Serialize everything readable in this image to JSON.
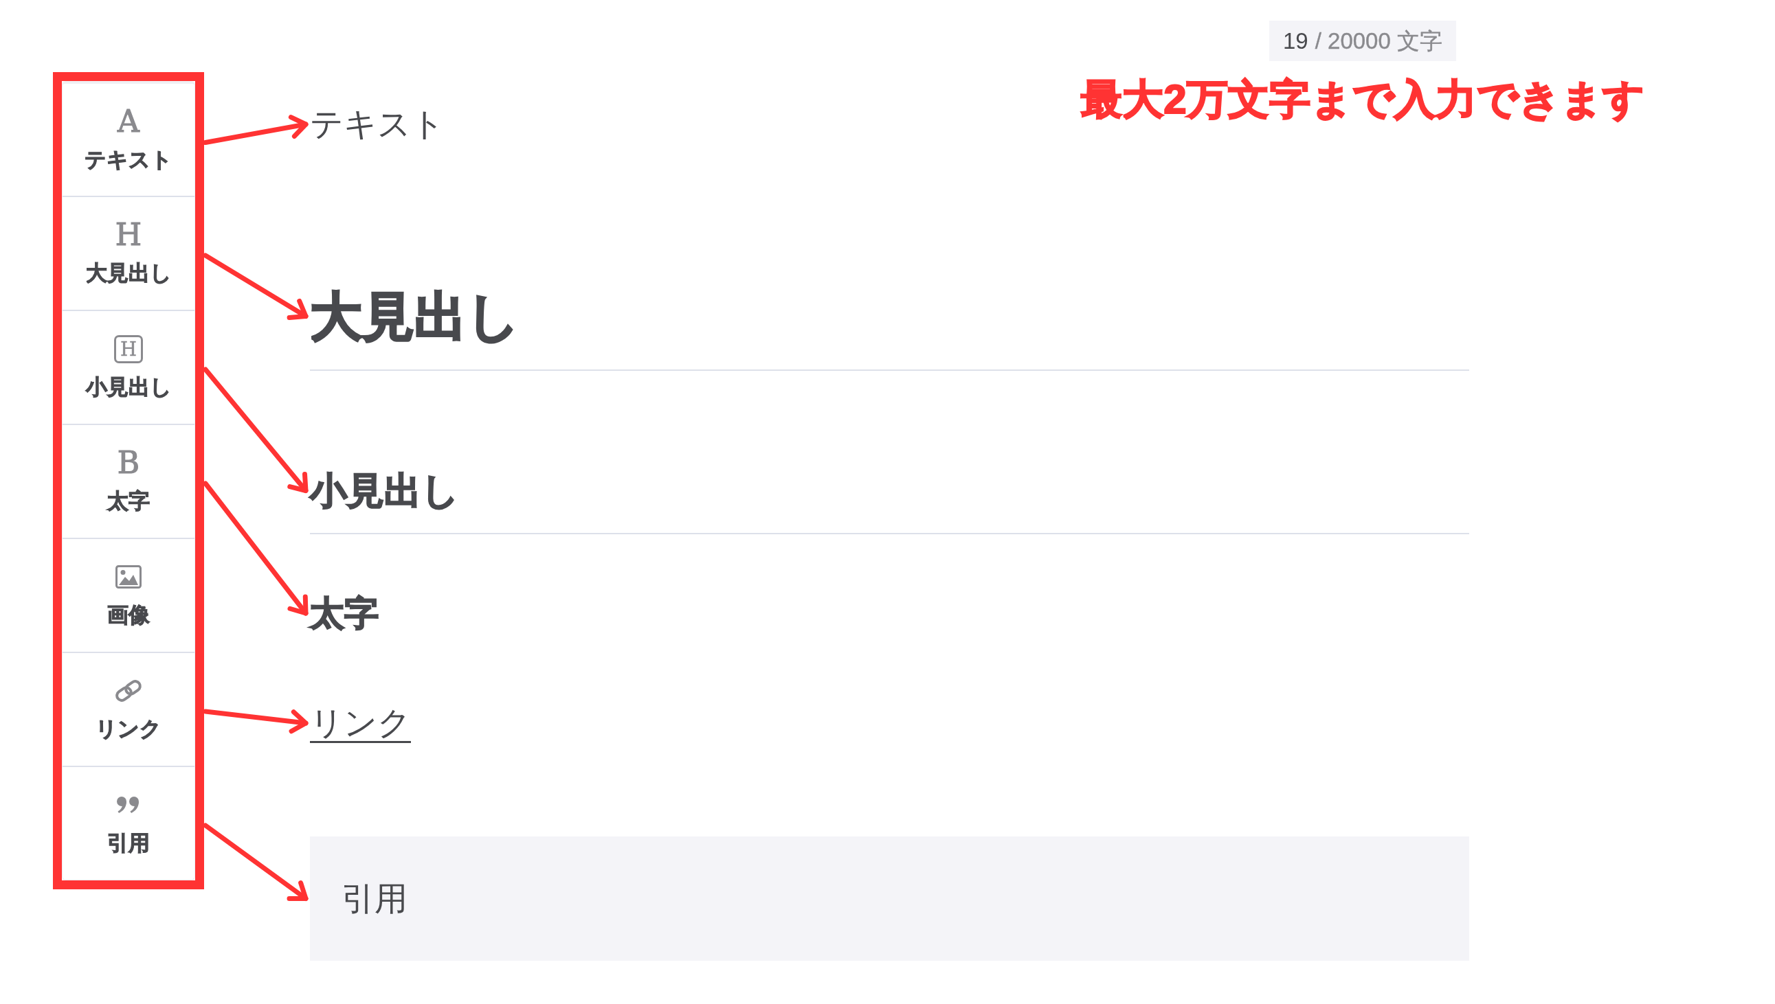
{
  "counter": {
    "count": "19",
    "limit": "/ 20000 文字"
  },
  "annotation": {
    "note": "最大2万文字まで入力できます"
  },
  "toolbar": {
    "items": [
      {
        "kind": "text",
        "glyph": "A",
        "label": "テキスト"
      },
      {
        "kind": "heading",
        "glyph": "H",
        "label": "大見出し"
      },
      {
        "kind": "subheading",
        "glyph": "H",
        "label": "小見出し"
      },
      {
        "kind": "bold",
        "glyph": "B",
        "label": "太字"
      },
      {
        "kind": "image",
        "label": "画像"
      },
      {
        "kind": "link",
        "label": "リンク"
      },
      {
        "kind": "quote",
        "label": "引用"
      }
    ]
  },
  "editor": {
    "blocks": [
      {
        "kind": "text",
        "text": "テキスト",
        "arrow": true
      },
      {
        "kind": "heading",
        "text": "大見出し",
        "arrow": true
      },
      {
        "kind": "subheading",
        "text": "小見出し",
        "arrow": true
      },
      {
        "kind": "bold",
        "text": "太字",
        "arrow": true
      },
      {
        "kind": "link",
        "text": "リンク",
        "arrow": true
      },
      {
        "kind": "quote",
        "text": "引用",
        "arrow": true
      }
    ]
  }
}
